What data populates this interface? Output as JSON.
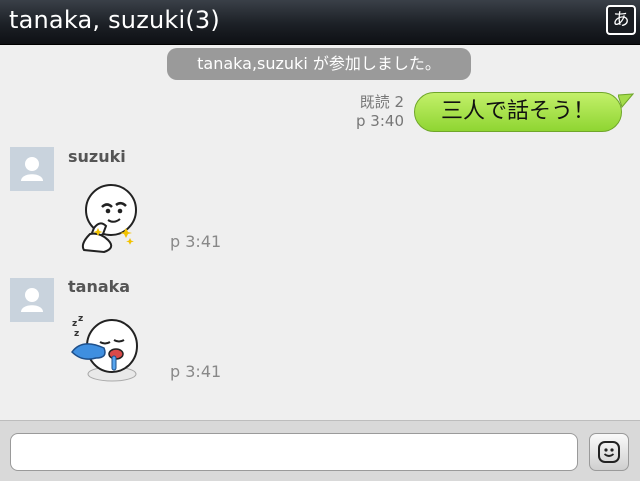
{
  "header": {
    "title": "tanaka, suzuki(3)",
    "ime_label": "あ"
  },
  "system_message": "tanaka,suzuki が参加しました。",
  "messages": [
    {
      "read_status": "既読 2",
      "time": "p 3:40",
      "text": "三人で話そう！"
    },
    {
      "sender": "suzuki",
      "time": "p 3:41",
      "sticker": "smirk-pointing-sticker"
    },
    {
      "sender": "tanaka",
      "time": "p 3:41",
      "sticker": "sleeping-drool-sticker"
    }
  ],
  "composer": {
    "value": "",
    "placeholder": ""
  },
  "colors": {
    "bubble": "#9fe048",
    "titlebar": "#1c2026",
    "background": "#efefef",
    "system_badge": "#9a9a9a"
  },
  "icons": {
    "avatar": "person-silhouette-icon",
    "emoji": "smiley-icon"
  }
}
